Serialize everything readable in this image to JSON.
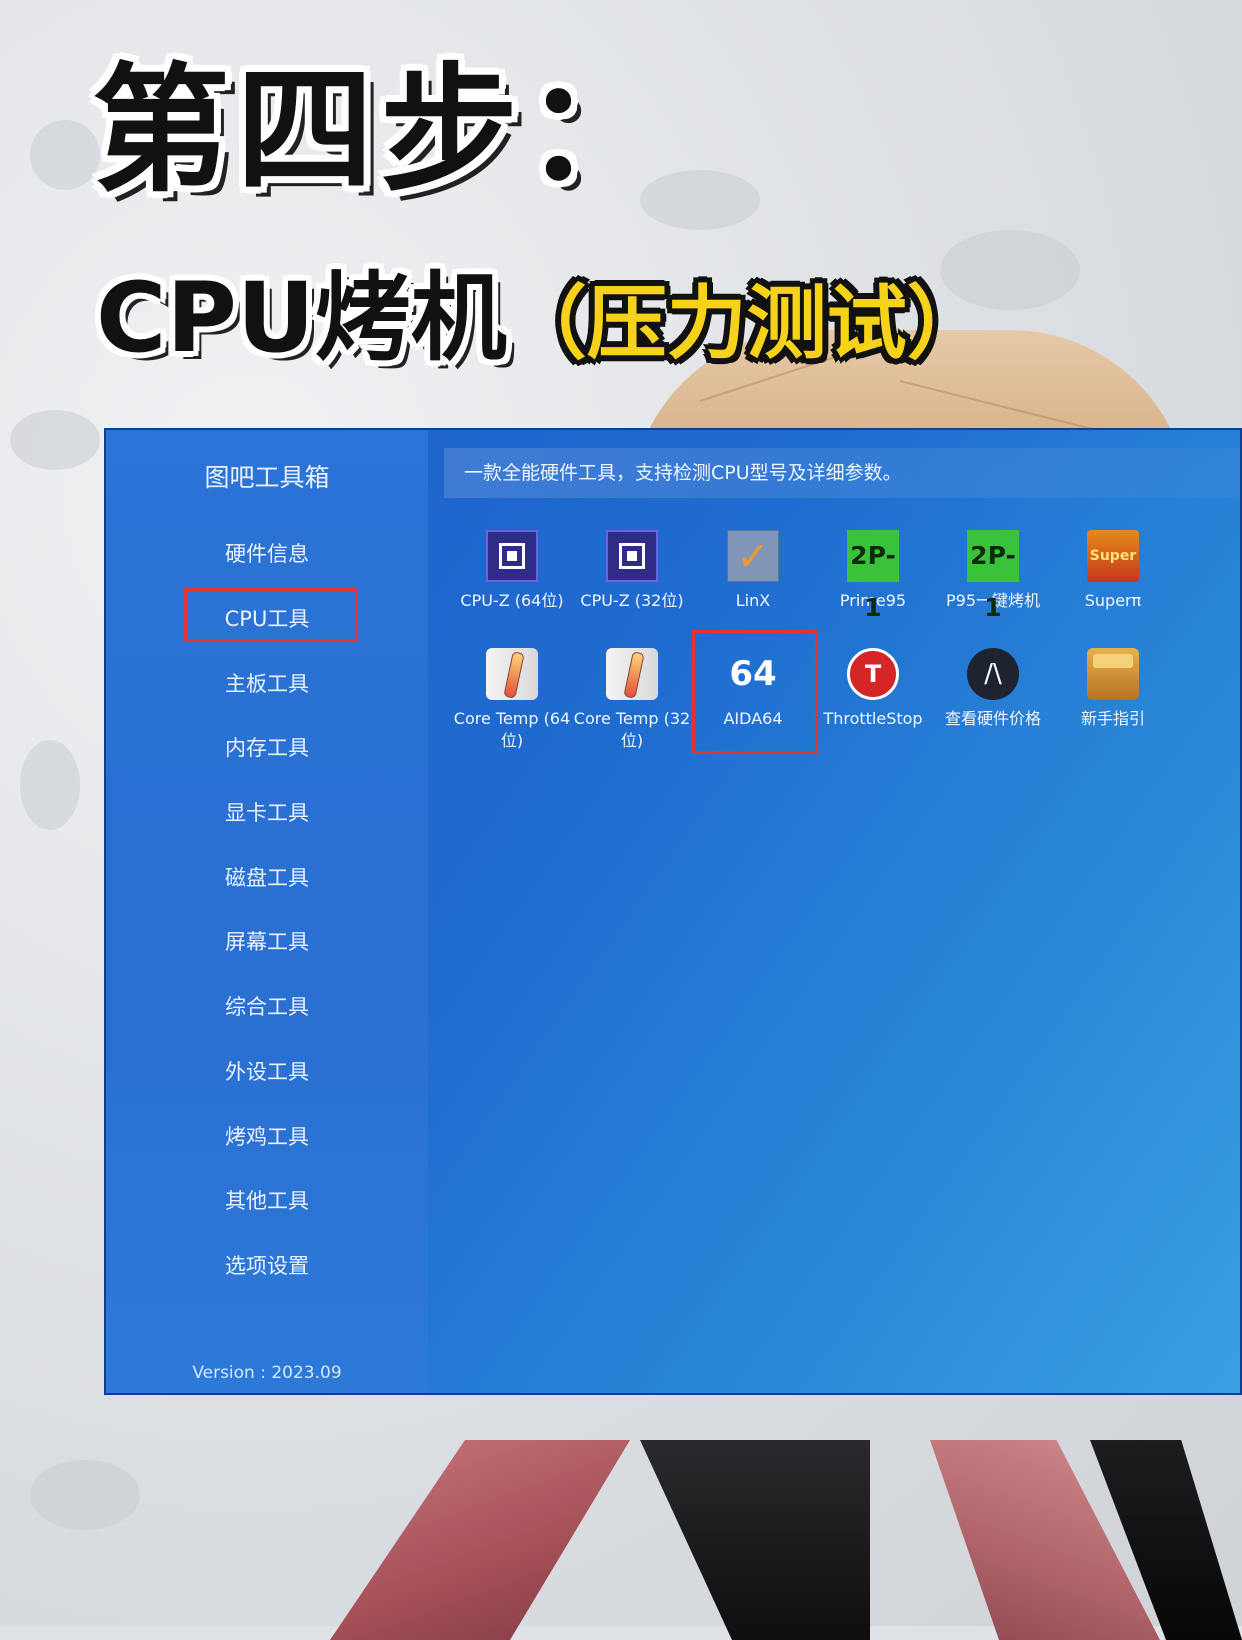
{
  "headline": {
    "line1": "第四步：",
    "line2_main": "CPU烤机",
    "line2_paren": "（压力测试）"
  },
  "app": {
    "title": "图吧工具箱",
    "description": "一款全能硬件工具，支持检测CPU型号及详细参数。",
    "version": "Version : 2023.09",
    "sidebar": [
      {
        "label": "硬件信息"
      },
      {
        "label": "CPU工具",
        "active": true
      },
      {
        "label": "主板工具"
      },
      {
        "label": "内存工具"
      },
      {
        "label": "显卡工具"
      },
      {
        "label": "磁盘工具"
      },
      {
        "label": "屏幕工具"
      },
      {
        "label": "综合工具"
      },
      {
        "label": "外设工具"
      },
      {
        "label": "烤鸡工具"
      },
      {
        "label": "其他工具"
      },
      {
        "label": "选项设置"
      }
    ],
    "tools": [
      {
        "label": "CPU-Z (64位)",
        "icon": "cpu-z-icon"
      },
      {
        "label": "CPU-Z (32位)",
        "icon": "cpu-z-icon"
      },
      {
        "label": "LinX",
        "icon": "linx-checkmark-icon"
      },
      {
        "label": "Prime95",
        "icon": "prime95-icon",
        "icon_text": "2P-1"
      },
      {
        "label": "P95一键烤机",
        "icon": "prime95-icon",
        "icon_text": "2P-1"
      },
      {
        "label": "Superπ",
        "icon": "superpi-icon",
        "icon_text": "Super"
      },
      {
        "label": "Core Temp (64位)",
        "icon": "thermometer-icon"
      },
      {
        "label": "Core Temp (32位)",
        "icon": "thermometer-icon"
      },
      {
        "label": "AIDA64",
        "icon": "aida64-icon",
        "icon_text": "64",
        "highlighted": true
      },
      {
        "label": "ThrottleStop",
        "icon": "throttlestop-icon",
        "icon_text": "T"
      },
      {
        "label": "查看硬件价格",
        "icon": "price-icon",
        "icon_text": "/\\"
      },
      {
        "label": "新手指引",
        "icon": "guide-box-icon"
      }
    ]
  },
  "colors": {
    "app_blue": "#1f6cd0",
    "highlight_red": "#e53333",
    "headline_yellow": "#f6d21a"
  }
}
